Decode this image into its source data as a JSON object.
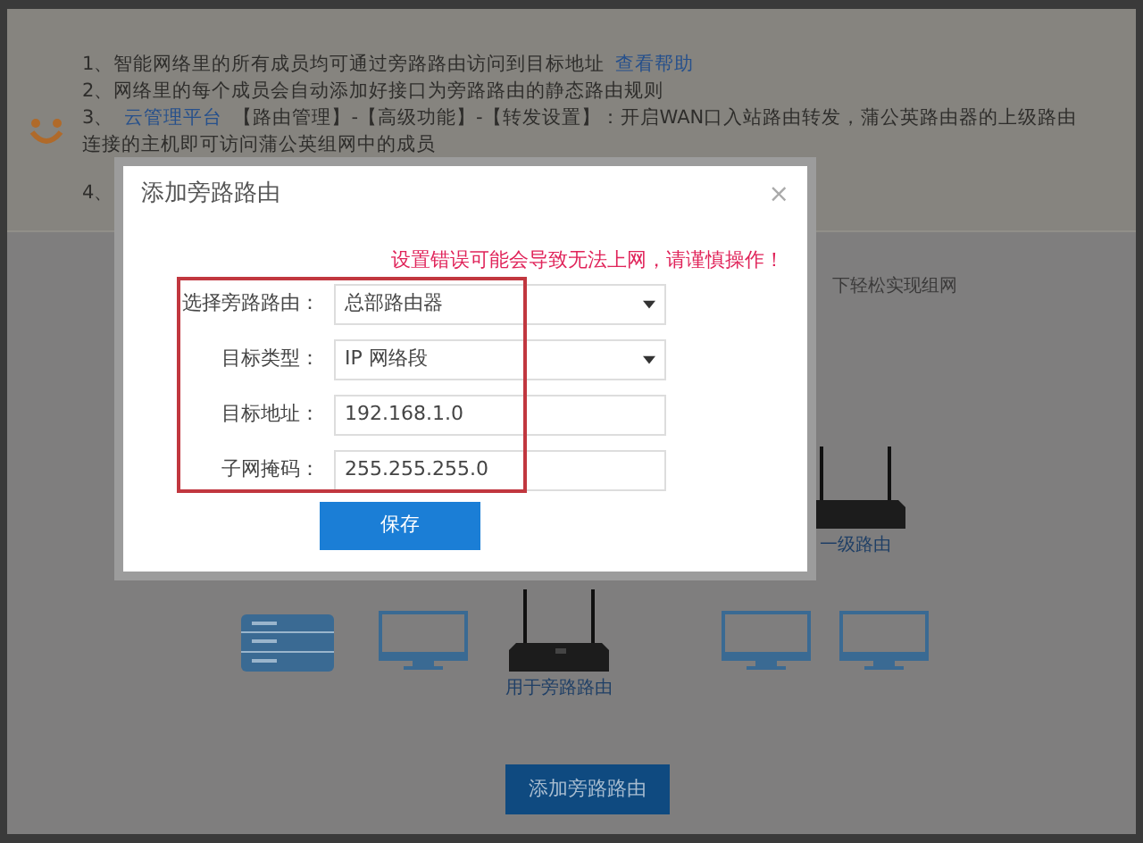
{
  "notice": {
    "lines": [
      {
        "parts": [
          {
            "text": "1、智能网络里的所有成员均可通过旁路路由访问到目标地址",
            "link": false
          },
          {
            "text": "查看帮助",
            "link": true
          }
        ]
      },
      {
        "parts": [
          {
            "text": "2、网络里的每个成员会自动添加好接口为旁路路由的静态路由规则",
            "link": false
          }
        ]
      },
      {
        "parts": [
          {
            "text": "3、",
            "link": false
          },
          {
            "text": "云管理平台",
            "link": true
          },
          {
            "text": "【路由管理】-【高级功能】-【转发设置】：开启WAN口入站路由转发，蒲公英路由器的上级路由连接的主机即可访问蒲公英组网中的成员",
            "link": false
          }
        ]
      },
      {
        "parts": [
          {
            "text": "4、",
            "link": false
          }
        ]
      }
    ]
  },
  "diagram": {
    "caption_right": "下轻松实现组网",
    "devices": [
      {
        "kind": "server"
      },
      {
        "kind": "monitor"
      },
      {
        "kind": "router",
        "label": "用于旁路路由"
      },
      {
        "kind": "router_partial",
        "label": "一级路由"
      },
      {
        "kind": "monitor"
      },
      {
        "kind": "monitor"
      }
    ]
  },
  "add_button": "添加旁路路由",
  "dialog": {
    "title": "添加旁路路由",
    "close": "×",
    "warning": "设置错误可能会导致无法上网，请谨慎操作！",
    "fields": [
      {
        "label": "选择旁路路由：",
        "kind": "select",
        "value": "总部路由器"
      },
      {
        "label": "目标类型：",
        "kind": "select",
        "value": "IP 网络段"
      },
      {
        "label": "目标地址：",
        "kind": "input",
        "value": "192.168.1.0"
      },
      {
        "label": "子网掩码：",
        "kind": "input",
        "value": "255.255.255.0"
      }
    ],
    "save": "保存"
  }
}
